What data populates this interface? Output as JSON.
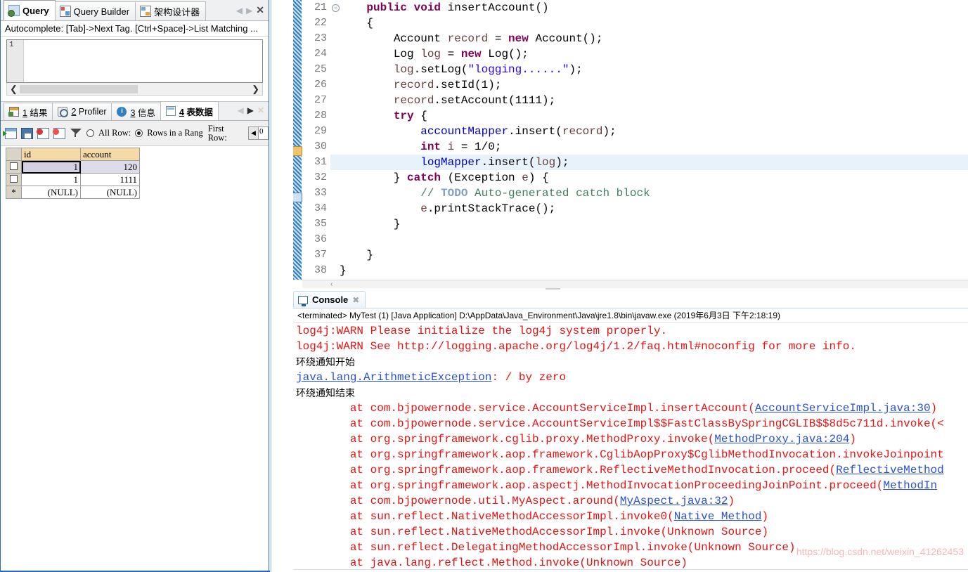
{
  "left_panel": {
    "tabs": [
      {
        "label": "Query",
        "icon": "query-icon",
        "active": true
      },
      {
        "label": "Query Builder",
        "icon": "query-builder-icon",
        "active": false
      },
      {
        "label": "架构设计器",
        "icon": "schema-designer-icon",
        "active": false
      }
    ],
    "tab_nav": {
      "prev": "◀",
      "next": "▶",
      "close": "✕"
    },
    "autocomplete_hint": "Autocomplete: [Tab]->Next Tag. [Ctrl+Space]->List Matching ...",
    "sql_editor": {
      "line_number": "1",
      "content": ""
    },
    "result_tabs": [
      {
        "number": "1",
        "label": "结果",
        "icon": "results-grid-icon",
        "active": false
      },
      {
        "number": "2",
        "label": "Profiler",
        "icon": "profiler-icon",
        "active": false
      },
      {
        "number": "3",
        "label": "信息",
        "icon": "info-icon",
        "active": false
      },
      {
        "number": "4",
        "label": "表数据",
        "icon": "table-data-icon",
        "active": true
      }
    ],
    "result_nav": {
      "prev": "◀",
      "next": "▶",
      "close": "✕"
    },
    "grid_toolbar": {
      "icons": [
        "add-row-icon",
        "save-changes-icon",
        "delete-row-icon",
        "delete-all-rows-icon",
        "filter-icon"
      ],
      "all_row_label": "All Row:",
      "rows_in_range_label": "Rows in a Rang",
      "first_row_label_1": "First",
      "first_row_label_2": "Row:",
      "first_row_value": "0",
      "spinner_left": "◀",
      "all_row_selected": false,
      "rows_in_range_selected": true
    },
    "table": {
      "columns": [
        "id",
        "account"
      ],
      "rows": [
        {
          "marker": "checkbox",
          "cells": [
            "1",
            "120"
          ],
          "selected": true
        },
        {
          "marker": "checkbox",
          "cells": [
            "1",
            "1111"
          ],
          "selected": false
        },
        {
          "marker": "*",
          "cells": [
            "(NULL)",
            "(NULL)"
          ],
          "selected": false
        }
      ]
    }
  },
  "editor": {
    "lines": [
      {
        "no": "21",
        "fold": true,
        "marker": "",
        "tokens": [
          {
            "t": "    ",
            "c": "plain"
          },
          {
            "t": "public",
            "c": "kw"
          },
          {
            "t": " ",
            "c": "plain"
          },
          {
            "t": "void",
            "c": "kw"
          },
          {
            "t": " insertAccount()",
            "c": "plain"
          }
        ]
      },
      {
        "no": "22",
        "fold": false,
        "marker": "",
        "tokens": [
          {
            "t": "    {",
            "c": "plain"
          }
        ]
      },
      {
        "no": "23",
        "fold": false,
        "marker": "",
        "tokens": [
          {
            "t": "        Account ",
            "c": "plain"
          },
          {
            "t": "record",
            "c": "loc"
          },
          {
            "t": " = ",
            "c": "plain"
          },
          {
            "t": "new",
            "c": "kw"
          },
          {
            "t": " Account();",
            "c": "plain"
          }
        ]
      },
      {
        "no": "24",
        "fold": false,
        "marker": "",
        "tokens": [
          {
            "t": "        Log ",
            "c": "plain"
          },
          {
            "t": "log",
            "c": "loc"
          },
          {
            "t": " = ",
            "c": "plain"
          },
          {
            "t": "new",
            "c": "kw"
          },
          {
            "t": " Log();",
            "c": "plain"
          }
        ]
      },
      {
        "no": "25",
        "fold": false,
        "marker": "",
        "tokens": [
          {
            "t": "        ",
            "c": "plain"
          },
          {
            "t": "log",
            "c": "loc"
          },
          {
            "t": ".setLog(",
            "c": "plain"
          },
          {
            "t": "\"logging......\"",
            "c": "str"
          },
          {
            "t": ");",
            "c": "plain"
          }
        ]
      },
      {
        "no": "26",
        "fold": false,
        "marker": "",
        "tokens": [
          {
            "t": "        ",
            "c": "plain"
          },
          {
            "t": "record",
            "c": "loc"
          },
          {
            "t": ".setId(1);",
            "c": "plain"
          }
        ]
      },
      {
        "no": "27",
        "fold": false,
        "marker": "",
        "tokens": [
          {
            "t": "        ",
            "c": "plain"
          },
          {
            "t": "record",
            "c": "loc"
          },
          {
            "t": ".setAccount(1111);",
            "c": "plain"
          }
        ]
      },
      {
        "no": "28",
        "fold": false,
        "marker": "",
        "tokens": [
          {
            "t": "        ",
            "c": "plain"
          },
          {
            "t": "try",
            "c": "kw"
          },
          {
            "t": " {",
            "c": "plain"
          }
        ]
      },
      {
        "no": "29",
        "fold": false,
        "marker": "",
        "tokens": [
          {
            "t": "            ",
            "c": "plain"
          },
          {
            "t": "accountMapper",
            "c": "fld"
          },
          {
            "t": ".insert(",
            "c": "plain"
          },
          {
            "t": "record",
            "c": "loc"
          },
          {
            "t": ");",
            "c": "plain"
          }
        ]
      },
      {
        "no": "30",
        "fold": false,
        "marker": "warning",
        "tokens": [
          {
            "t": "            ",
            "c": "plain"
          },
          {
            "t": "int",
            "c": "kw"
          },
          {
            "t": " ",
            "c": "plain"
          },
          {
            "t": "i",
            "c": "loc"
          },
          {
            "t": " = 1/0;",
            "c": "plain"
          }
        ]
      },
      {
        "no": "31",
        "fold": false,
        "marker": "",
        "highlight": true,
        "tokens": [
          {
            "t": "            ",
            "c": "plain"
          },
          {
            "t": "logMapper",
            "c": "fld"
          },
          {
            "t": ".insert(",
            "c": "plain"
          },
          {
            "t": "log",
            "c": "loc"
          },
          {
            "t": ");",
            "c": "plain"
          }
        ]
      },
      {
        "no": "32",
        "fold": false,
        "marker": "",
        "tokens": [
          {
            "t": "        } ",
            "c": "plain"
          },
          {
            "t": "catch",
            "c": "kw"
          },
          {
            "t": " (Exception ",
            "c": "plain"
          },
          {
            "t": "e",
            "c": "loc"
          },
          {
            "t": ") {",
            "c": "plain"
          }
        ]
      },
      {
        "no": "33",
        "fold": false,
        "marker": "todo",
        "tokens": [
          {
            "t": "            ",
            "c": "plain"
          },
          {
            "t": "// ",
            "c": "cmt"
          },
          {
            "t": "TODO",
            "c": "todo"
          },
          {
            "t": " Auto-generated catch block",
            "c": "cmt"
          }
        ]
      },
      {
        "no": "34",
        "fold": false,
        "marker": "",
        "tokens": [
          {
            "t": "            ",
            "c": "plain"
          },
          {
            "t": "e",
            "c": "loc"
          },
          {
            "t": ".printStackTrace();",
            "c": "plain"
          }
        ]
      },
      {
        "no": "35",
        "fold": false,
        "marker": "",
        "tokens": [
          {
            "t": "        }",
            "c": "plain"
          }
        ]
      },
      {
        "no": "36",
        "fold": false,
        "marker": "",
        "tokens": [
          {
            "t": "",
            "c": "plain"
          }
        ]
      },
      {
        "no": "37",
        "fold": false,
        "marker": "",
        "tokens": [
          {
            "t": "    }",
            "c": "plain"
          }
        ]
      },
      {
        "no": "38",
        "fold": false,
        "marker": "",
        "tokens": [
          {
            "t": "}",
            "c": "plain"
          }
        ]
      }
    ],
    "hscroll_arrow": "‹"
  },
  "console": {
    "tab_label": "Console",
    "tab_icon": "console-icon",
    "close_icon": "✖",
    "launch_info": "<terminated> MyTest (1) [Java Application] D:\\AppData\\Java_Environment\\Java\\jre1.8\\bin\\javaw.exe (2019年6月3日 下午2:18:19)",
    "output": [
      {
        "style": "red",
        "segments": [
          {
            "t": "log4j:WARN Please initialize the log4j system properly.",
            "l": false
          }
        ]
      },
      {
        "style": "red",
        "segments": [
          {
            "t": "log4j:WARN See http://logging.apache.org/log4j/1.2/faq.html#noconfig for more info.",
            "l": false
          }
        ]
      },
      {
        "style": "black",
        "segments": [
          {
            "t": "环绕通知开始",
            "l": false
          }
        ]
      },
      {
        "style": "red",
        "segments": [
          {
            "t": "java.lang.ArithmeticException",
            "l": true
          },
          {
            "t": ": / by zero",
            "l": false
          }
        ]
      },
      {
        "style": "black",
        "segments": [
          {
            "t": "环绕通知结束",
            "l": false
          }
        ]
      },
      {
        "style": "red",
        "segments": [
          {
            "t": "\tat com.bjpowernode.service.AccountServiceImpl.insertAccount(",
            "l": false
          },
          {
            "t": "AccountServiceImpl.java:30",
            "l": true
          },
          {
            "t": ")",
            "l": false
          }
        ]
      },
      {
        "style": "red",
        "segments": [
          {
            "t": "\tat com.bjpowernode.service.AccountServiceImpl$$FastClassBySpringCGLIB$$8d5c711d.invoke(",
            "l": false
          },
          {
            "t": "<",
            "l": false
          }
        ]
      },
      {
        "style": "red",
        "segments": [
          {
            "t": "\tat org.springframework.cglib.proxy.MethodProxy.invoke(",
            "l": false
          },
          {
            "t": "MethodProxy.java:204",
            "l": true
          },
          {
            "t": ")",
            "l": false
          }
        ]
      },
      {
        "style": "red",
        "segments": [
          {
            "t": "\tat org.springframework.aop.framework.CglibAopProxy$CglibMethodInvocation.invokeJoinpoint",
            "l": false
          }
        ]
      },
      {
        "style": "red",
        "segments": [
          {
            "t": "\tat org.springframework.aop.framework.ReflectiveMethodInvocation.proceed(",
            "l": false
          },
          {
            "t": "ReflectiveMethod",
            "l": true
          }
        ]
      },
      {
        "style": "red",
        "segments": [
          {
            "t": "\tat org.springframework.aop.aspectj.MethodInvocationProceedingJoinPoint.proceed(",
            "l": false
          },
          {
            "t": "MethodIn",
            "l": true
          }
        ]
      },
      {
        "style": "red",
        "segments": [
          {
            "t": "\tat com.bjpowernode.util.MyAspect.around(",
            "l": false
          },
          {
            "t": "MyAspect.java:32",
            "l": true
          },
          {
            "t": ")",
            "l": false
          }
        ]
      },
      {
        "style": "red",
        "segments": [
          {
            "t": "\tat sun.reflect.NativeMethodAccessorImpl.invoke0(",
            "l": false
          },
          {
            "t": "Native Method",
            "l": true
          },
          {
            "t": ")",
            "l": false
          }
        ]
      },
      {
        "style": "red",
        "segments": [
          {
            "t": "\tat sun.reflect.NativeMethodAccessorImpl.invoke(Unknown Source)",
            "l": false
          }
        ]
      },
      {
        "style": "red",
        "segments": [
          {
            "t": "\tat sun.reflect.DelegatingMethodAccessorImpl.invoke(Unknown Source)",
            "l": false
          }
        ]
      },
      {
        "style": "red",
        "segments": [
          {
            "t": "\tat java.lang.reflect.Method.invoke(Unknown Source)",
            "l": false
          }
        ]
      }
    ],
    "watermark": "https://blog.csdn.net/weixin_41262453"
  }
}
